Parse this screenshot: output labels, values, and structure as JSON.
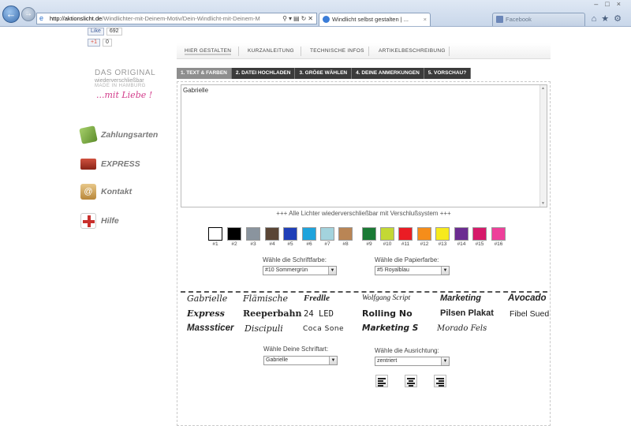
{
  "browser": {
    "address_host": "http://aktionslicht.de",
    "address_path": "/Windlichter-mit-Deinem-Motiv/Dein-Windlicht-mit-Deinem-M",
    "tab_active": "Windlicht selbst gestalten | ...",
    "tab_inactive": "Facebook"
  },
  "social": {
    "like_label": "Like",
    "like_count": "692",
    "plus_label": "+1",
    "plus_count": "0"
  },
  "logo": {
    "line1": "DAS ORIGINAL",
    "line2": "wiederverschließbar",
    "line3": "MADE IN HAMBURG",
    "line4": "...mit Liebe !"
  },
  "sidebar": {
    "items": [
      {
        "label": "Zahlungsarten",
        "icon": "money-icon"
      },
      {
        "label": "EXPRESS",
        "icon": "truck-icon"
      },
      {
        "label": "Kontakt",
        "icon": "mail-icon"
      },
      {
        "label": "Hilfe",
        "icon": "first-aid-icon"
      }
    ]
  },
  "topnav": {
    "tabs": [
      "HIER GESTALTEN",
      "KURZANLEITUNG",
      "TECHNISCHE INFOS",
      "ARTIKELBESCHREIBUNG"
    ]
  },
  "steps": [
    "1. TEXT & FARBEN",
    "2. DATEI HOCHLADEN",
    "3. GRÖßE WÄHLEN",
    "4. DEINE ANMERKUNGEN",
    "5. VORSCHAU?"
  ],
  "editor": {
    "text_value": "Gabrielle",
    "info": "+++ Alle Lichter wiederverschließbar mit Verschlußsystem +++"
  },
  "colors": [
    {
      "label": "#1",
      "hex": "#ffffff"
    },
    {
      "label": "#2",
      "hex": "#000000"
    },
    {
      "label": "#3",
      "hex": "#8a949e"
    },
    {
      "label": "#4",
      "hex": "#5a4535"
    },
    {
      "label": "#5",
      "hex": "#1f3fb8"
    },
    {
      "label": "#6",
      "hex": "#1ea3dc"
    },
    {
      "label": "#7",
      "hex": "#a3d3dd"
    },
    {
      "label": "#8",
      "hex": "#b98555"
    },
    {
      "label": "#9",
      "hex": "#1a7a35"
    },
    {
      "label": "#10",
      "hex": "#c3d834"
    },
    {
      "label": "#11",
      "hex": "#ea1c24"
    },
    {
      "label": "#12",
      "hex": "#f58d1a"
    },
    {
      "label": "#13",
      "hex": "#f7ea1d"
    },
    {
      "label": "#14",
      "hex": "#6c2c91"
    },
    {
      "label": "#15",
      "hex": "#d6196a"
    },
    {
      "label": "#16",
      "hex": "#ee3f9a"
    }
  ],
  "selects": {
    "font_color_label": "Wähle die Schriftfarbe:",
    "font_color_value": "#10 Sommergrün",
    "paper_color_label": "Wähle die Papierfarbe:",
    "paper_color_value": "#5 Royalblau",
    "font_label": "Wähle Deine Schriftart:",
    "font_value": "Gabrielle",
    "align_label": "Wähle die Ausrichtung:",
    "align_value": "zentriert"
  },
  "fonts": [
    "Gabrielle",
    "Flämische",
    "Fredlle",
    "Wolfgang Script",
    "Marketing",
    "Avocado",
    "Express",
    "Reeperbahn",
    "24 LED",
    "Rolling No",
    "Pilsen Plakat",
    "Fibel Sued",
    "Masssticer",
    "Discipuli",
    "Coca Sone",
    "Marketing S",
    "Morado Fels"
  ]
}
